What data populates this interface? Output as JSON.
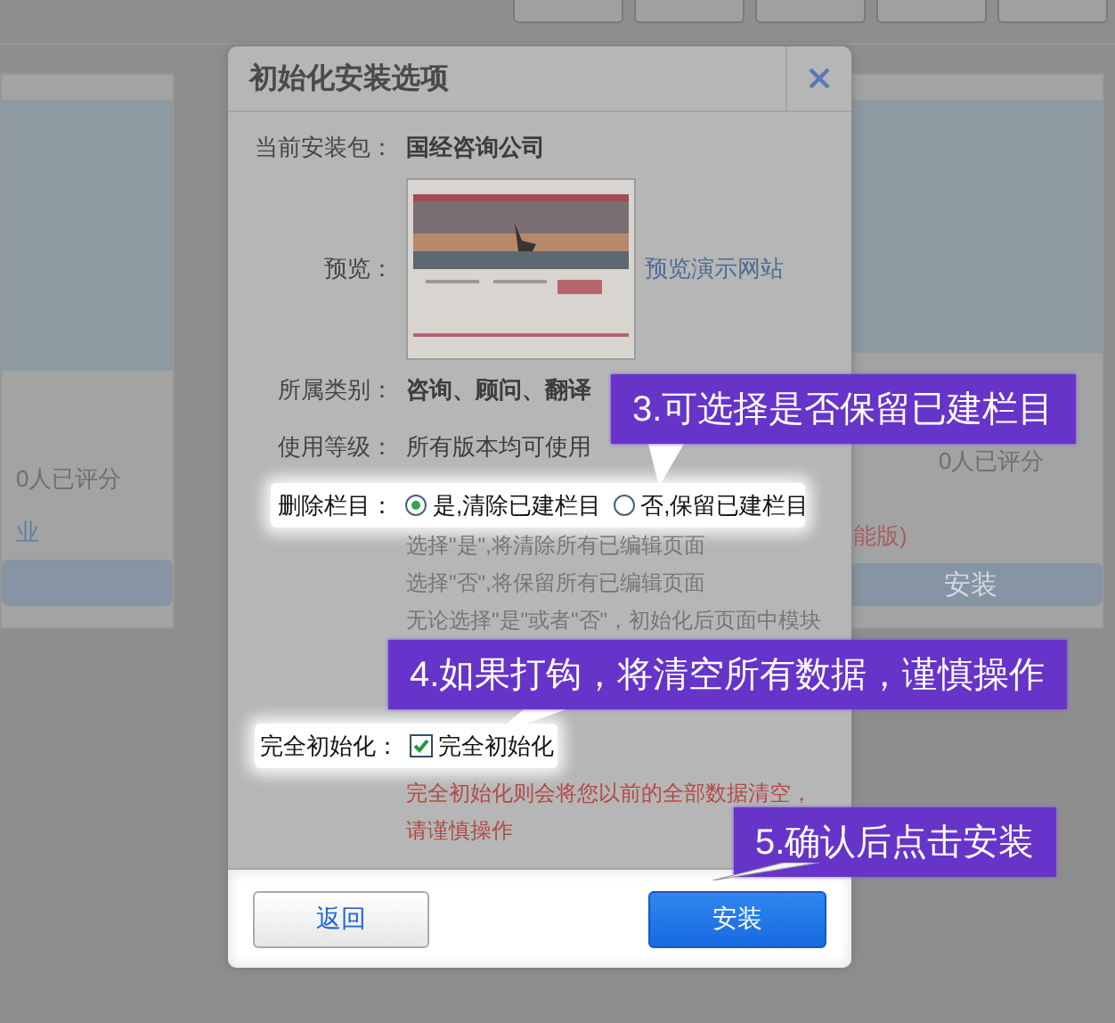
{
  "background": {
    "left_card": {
      "rating": "0人已评分",
      "link": "业"
    },
    "right_card": {
      "rating": "0人已评分",
      "note": "能版)",
      "button": "安装"
    }
  },
  "dialog": {
    "title": "初始化安装选项",
    "fields": [
      {
        "label": "当前安装包：",
        "value": "国经咨询公司",
        "kind": "bold"
      },
      {
        "label": "预览：",
        "kind": "preview",
        "link": "预览演示网站"
      },
      {
        "label": "所属类别：",
        "value": "咨询、顾问、翻译",
        "kind": "bold"
      },
      {
        "label": "使用等级：",
        "value": "所有版本均可使用",
        "kind": "plain"
      }
    ],
    "delete_columns": {
      "label": "删除栏目：",
      "options": [
        {
          "label": "是,清除已建栏目",
          "selected": true
        },
        {
          "label": "否,保留已建栏目",
          "selected": false
        }
      ]
    },
    "hints": [
      "选择\"是\",将清除所有已编辑页面",
      "选择\"否\",将保留所有已编辑页面",
      "无论选择\"是\"或者\"否\"，初始化后页面中模块"
    ],
    "full_init": {
      "label": "完全初始化：",
      "option": "完全初始化",
      "checked": true
    },
    "warning": [
      "完全初始化则会将您以前的全部数据清空，",
      "请谨慎操作"
    ],
    "buttons": [
      {
        "label": "返回",
        "kind": "secondary"
      },
      {
        "label": "安装",
        "kind": "primary"
      }
    ]
  },
  "callouts": [
    "3.可选择是否保留已建栏目",
    "4.如果打钩，将清空所有数据，谨慎操作",
    "5.确认后点击安装"
  ]
}
